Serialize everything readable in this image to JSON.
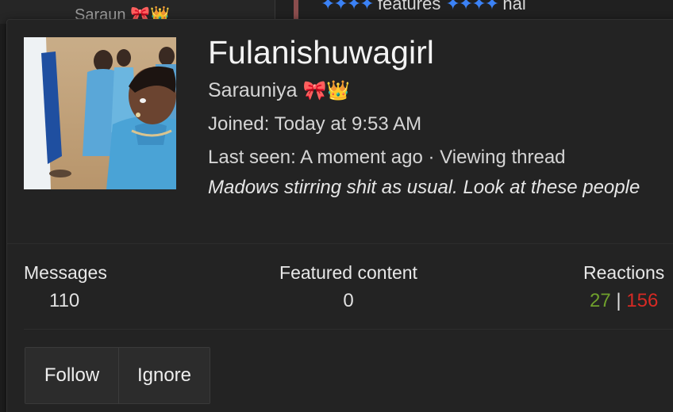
{
  "background": {
    "poster_name": "Saraun",
    "poster_name_emoji": "🎀👑",
    "post_text": "features",
    "post_text_right": "hai"
  },
  "card": {
    "username": "Fulanishuwagirl",
    "user_title": "Sarauniya",
    "user_title_emoji": "🎀👑",
    "joined_label": "Joined:",
    "joined_value": "Today at 9:53 AM",
    "last_seen_label": "Last seen:",
    "last_seen_value": "A moment ago · Viewing thread",
    "status_message": "Madows stirring shit as usual. Look at these people"
  },
  "stats": {
    "messages_label": "Messages",
    "messages_value": "110",
    "featured_label": "Featured content",
    "featured_value": "0",
    "reactions_label": "Reactions",
    "reactions_positive": "27",
    "reactions_separator": "|",
    "reactions_negative": "156"
  },
  "actions": {
    "follow_label": "Follow",
    "ignore_label": "Ignore"
  },
  "colors": {
    "reaction_positive": "#6fa02c",
    "reaction_negative": "#d62a24",
    "sparkle": "#3b82f6"
  }
}
